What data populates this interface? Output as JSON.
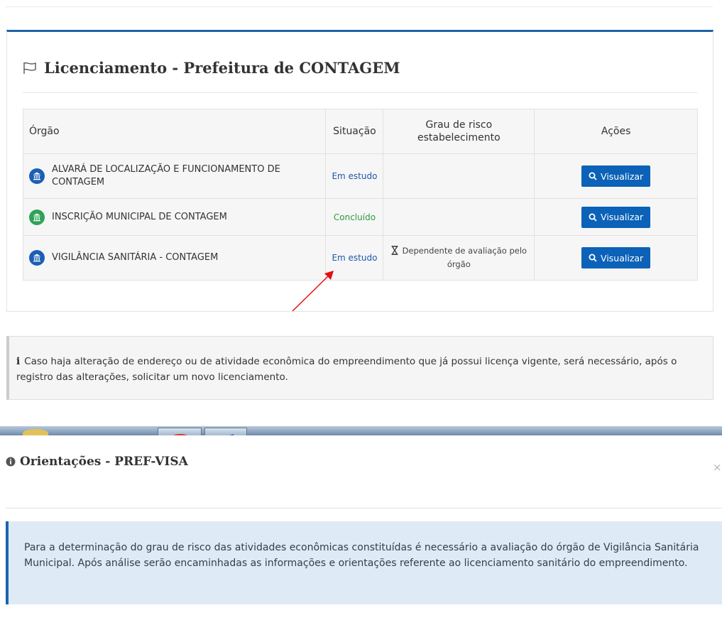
{
  "licensing": {
    "title": "Licenciamento - Prefeitura de CONTAGEM",
    "headers": {
      "orgao": "Órgão",
      "situacao": "Situação",
      "risco": "Grau de risco estabelecimento",
      "acoes": "Ações"
    },
    "rows": [
      {
        "orgao": "ALVARÁ DE LOCALIZAÇÃO E FUNCIONAMENTO DE CONTAGEM",
        "situacao": "Em estudo",
        "risco": "",
        "action": "Visualizar"
      },
      {
        "orgao": "INSCRIÇÃO MUNICIPAL DE CONTAGEM",
        "situacao": "Concluído",
        "risco": "",
        "action": "Visualizar"
      },
      {
        "orgao": "VIGILÂNCIA SANITÁRIA - CONTAGEM",
        "situacao": "Em estudo",
        "risco": "Dependente de avaliação pelo órgão",
        "action": "Visualizar"
      }
    ]
  },
  "info_notice": {
    "text": "Caso haja alteração de endereço ou de atividade econômica do empreendimento que já possui licença vigente, será necessário, após o registro das alterações, solicitar um novo licenciamento."
  },
  "modal": {
    "title": "Orientações - PREF-VISA",
    "close_label": "×",
    "body": "Para a determinação do grau de risco das atividades econômicas constituídas é necessário a avaliação do órgão de Vigilância Sanitária Municipal. Após análise serão encaminhadas as informações e orientações referente ao licenciamento sanitário do empreendimento."
  },
  "colors": {
    "primary": "#0b62b8",
    "status_in_study": "#1e56a8",
    "status_done": "#2d9a3f",
    "annotation": "#e01010",
    "modal_alert_bg": "#deebf6"
  },
  "icons": {
    "title": "flag-icon",
    "org_badge": "building-icon",
    "risk": "hourglass-icon",
    "action": "search-icon",
    "modal_title": "info-circle-icon",
    "notice": "info-icon"
  }
}
